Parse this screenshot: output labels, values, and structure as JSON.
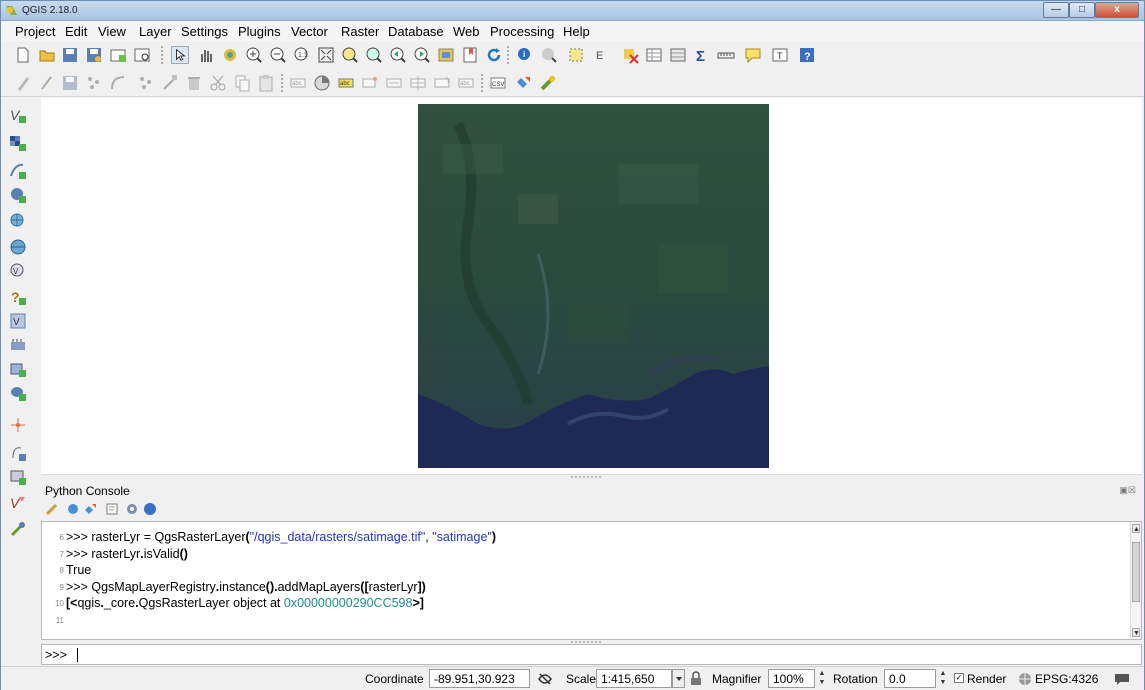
{
  "window": {
    "title": "QGIS 2.18.0",
    "min_icon": "minimize-icon",
    "max_icon": "maximize-icon",
    "close_label": "x"
  },
  "menu": [
    "Project",
    "Edit",
    "View",
    "Layer",
    "Settings",
    "Plugins",
    "Vector",
    "Raster",
    "Database",
    "Web",
    "Processing",
    "Help"
  ],
  "map": {
    "layer_name": "satimage",
    "icon": "satellite-raster-image"
  },
  "console": {
    "title": "Python Console",
    "lines": [
      {
        "num": "6",
        "parts": [
          {
            "t": ">>> rasterLyr = QgsRasterLayer",
            "c": ""
          },
          {
            "t": "(",
            "c": "bold"
          },
          {
            "t": "\"/qgis_data/rasters/satimage.tif\"",
            "c": "str"
          },
          {
            "t": ", ",
            "c": ""
          },
          {
            "t": "\"satimage\"",
            "c": "str"
          },
          {
            "t": ")",
            "c": "bold"
          }
        ]
      },
      {
        "num": "7",
        "parts": [
          {
            "t": ">>> rasterLyr",
            "c": ""
          },
          {
            "t": ".",
            "c": "bold"
          },
          {
            "t": "isValid",
            "c": ""
          },
          {
            "t": "()",
            "c": "bold"
          }
        ]
      },
      {
        "num": "8",
        "parts": [
          {
            "t": "True",
            "c": ""
          }
        ]
      },
      {
        "num": "9",
        "parts": [
          {
            "t": ">>> QgsMapLayerRegistry",
            "c": ""
          },
          {
            "t": ".",
            "c": "bold"
          },
          {
            "t": "instance",
            "c": ""
          },
          {
            "t": "().",
            "c": "bold"
          },
          {
            "t": "addMapLayers",
            "c": ""
          },
          {
            "t": "([",
            "c": "bold"
          },
          {
            "t": "rasterLyr",
            "c": ""
          },
          {
            "t": "])",
            "c": "bold"
          }
        ]
      },
      {
        "num": "10",
        "parts": [
          {
            "t": "[<",
            "c": "bold"
          },
          {
            "t": "qgis",
            "c": ""
          },
          {
            "t": ".",
            "c": "bold"
          },
          {
            "t": "_core",
            "c": ""
          },
          {
            "t": ".",
            "c": "bold"
          },
          {
            "t": "QgsRasterLayer object at ",
            "c": ""
          },
          {
            "t": "0x00000000290CC598",
            "c": "num"
          },
          {
            "t": ">]",
            "c": "bold"
          }
        ]
      },
      {
        "num": "11",
        "parts": []
      }
    ],
    "prompt": ">>>"
  },
  "status": {
    "coordinate_label": "Coordinate",
    "coordinate_value": "-89.951,30.923",
    "scale_label": "Scale",
    "scale_value": "1:415,650",
    "magnifier_label": "Magnifier",
    "magnifier_value": "100%",
    "rotation_label": "Rotation",
    "rotation_value": "0.0",
    "render_label": "Render",
    "crs_label": "EPSG:4326"
  }
}
